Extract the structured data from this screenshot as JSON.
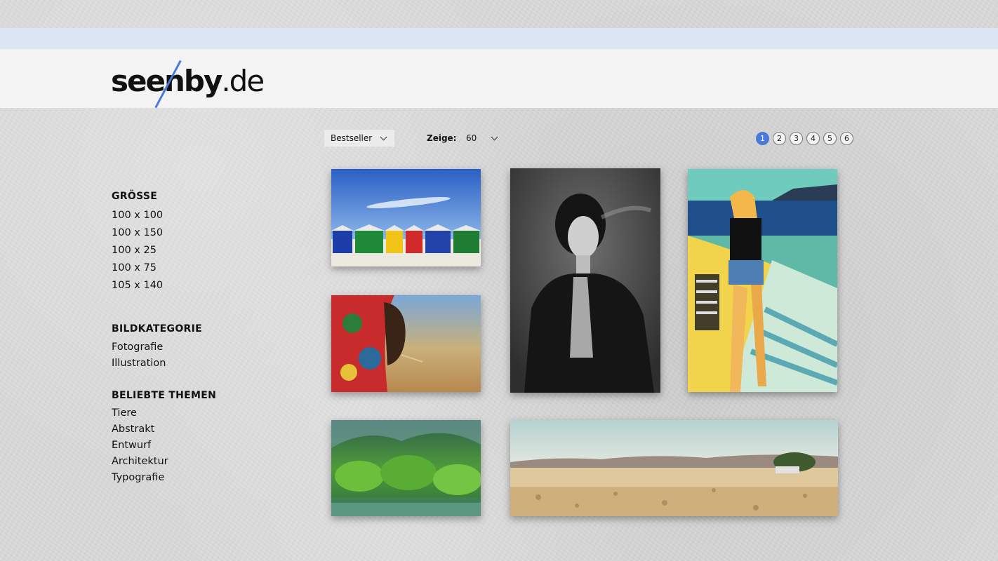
{
  "header": {
    "logo_part1": "seen",
    "logo_part2": "by",
    "logo_part3": ".de"
  },
  "colors": {
    "accent": "#4a7ad8",
    "header_bg": "#f3f3f3",
    "topbar_bg": "#dde6f5"
  },
  "sidebar": {
    "groups": [
      {
        "heading": "GRÖSSE",
        "items": [
          "100 x 100",
          "100 x 150",
          "100 x 25",
          "100 x 75",
          "105 x 140"
        ]
      },
      {
        "heading": "BILDKATEGORIE",
        "items": [
          "Fotografie",
          "Illustration"
        ]
      },
      {
        "heading": "BELIEBTE THEMEN",
        "items": [
          "Tiere",
          "Abstrakt",
          "Entwurf",
          "Architektur",
          "Typografie"
        ]
      }
    ]
  },
  "toolbar": {
    "sort_value": "Bestseller",
    "show_label": "Zeige:",
    "show_value": "60"
  },
  "pagination": {
    "pages": [
      "1",
      "2",
      "3",
      "4",
      "5",
      "6"
    ],
    "current": "1"
  },
  "tiles": [
    {
      "subject": "beach-huts"
    },
    {
      "subject": "woman-leather-jacket"
    },
    {
      "subject": "illustration-woman-stairs"
    },
    {
      "subject": "portrait-headscarf"
    },
    {
      "subject": "jungle-lake"
    },
    {
      "subject": "desert-panorama"
    }
  ]
}
